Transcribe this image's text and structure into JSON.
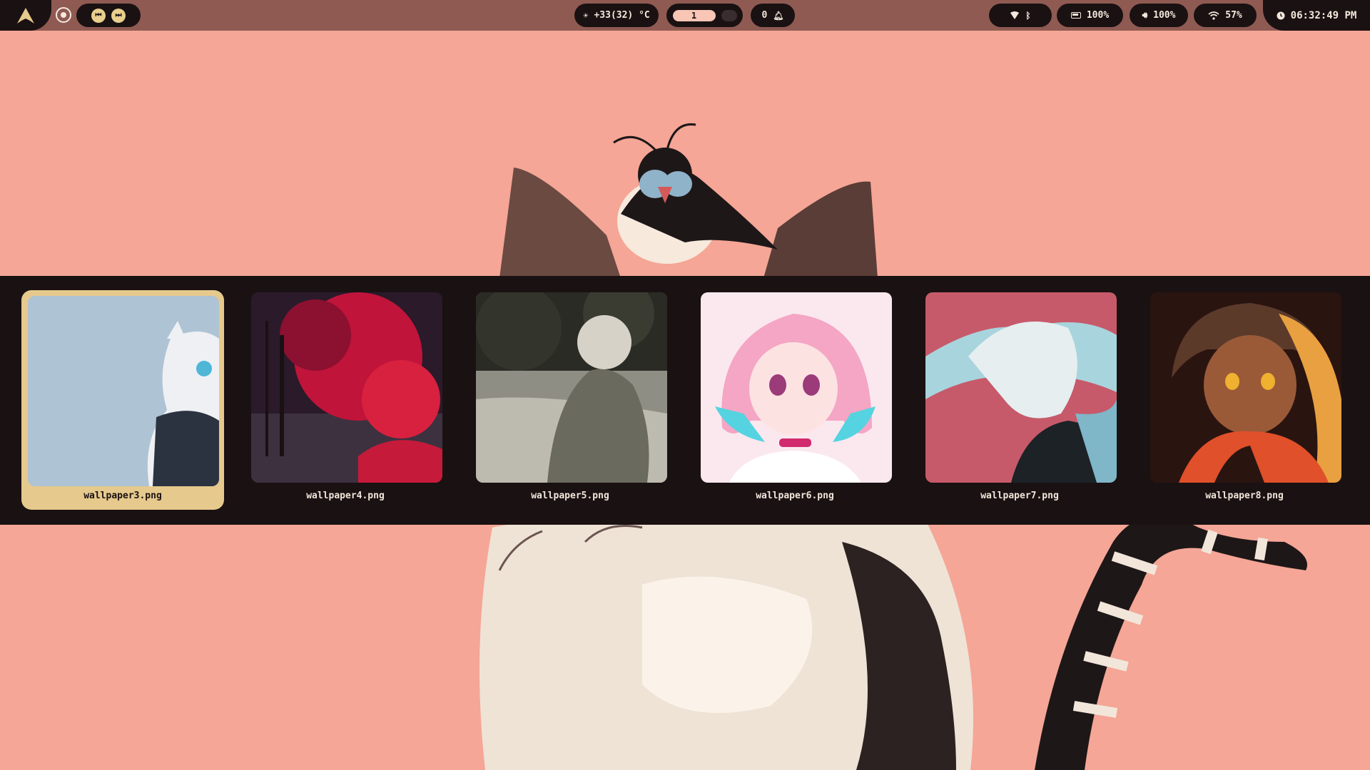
{
  "topbar": {
    "launcher_icon": "arch-logo-icon",
    "record_icon": "record-icon",
    "media": {
      "prev_icon": "previous-track-icon",
      "next_icon": "next-track-icon"
    },
    "weather": {
      "icon": "sun-icon",
      "text": "+33(32) °C"
    },
    "workspaces": {
      "active": "1"
    },
    "notifications": {
      "count": "0",
      "icon": "bell-icon"
    },
    "connectivity": {
      "network_icon": "network-icon",
      "bluetooth_icon": "bluetooth-icon"
    },
    "battery": {
      "icon": "battery-icon",
      "value": "100%"
    },
    "volume": {
      "icon": "volume-icon",
      "value": "100%"
    },
    "wifi": {
      "icon": "wifi-icon",
      "value": "57%"
    },
    "clock": {
      "icon": "clock-icon",
      "time": "06:32:49 PM"
    }
  },
  "wallpaper_picker": {
    "selected": "wallpaper3.png",
    "items": [
      {
        "label": "wallpaper3.png"
      },
      {
        "label": "wallpaper4.png"
      },
      {
        "label": "wallpaper5.png"
      },
      {
        "label": "wallpaper6.png"
      },
      {
        "label": "wallpaper7.png"
      },
      {
        "label": "wallpaper8.png"
      }
    ]
  },
  "colors": {
    "bar_background": "#8f5a52",
    "pill_background": "#1a1112",
    "accent_selected": "#e6c98c",
    "desktop_background": "#f5a696"
  }
}
